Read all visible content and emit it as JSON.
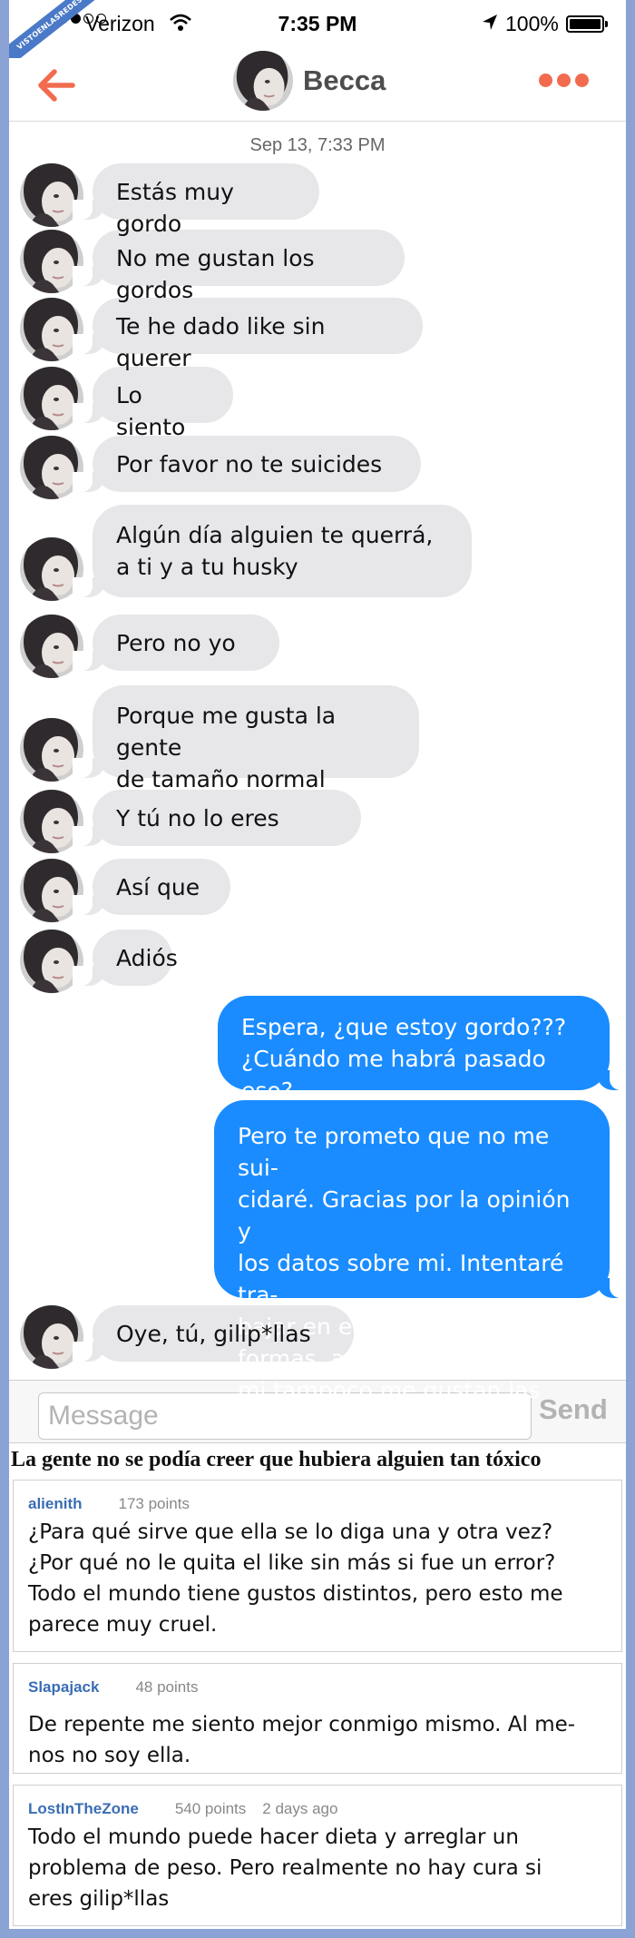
{
  "watermark": "VISTOENLASREDES",
  "status_bar": {
    "carrier": "Verizon",
    "time": "7:35 PM",
    "battery": "100%"
  },
  "nav": {
    "contact_name": "Becca",
    "back_icon": "arrow-left-icon",
    "more_icon": "more-dots-icon"
  },
  "chat": {
    "timestamp": "Sep 13, 7:33 PM",
    "messages": [
      {
        "from": "them",
        "text": "Estás muy gordo"
      },
      {
        "from": "them",
        "text": "No me gustan los gordos"
      },
      {
        "from": "them",
        "text": "Te he dado like sin querer"
      },
      {
        "from": "them",
        "text": "Lo siento"
      },
      {
        "from": "them",
        "text": "Por favor no te suicides"
      },
      {
        "from": "them",
        "text": "Algún día alguien te querrá,\na ti y a tu husky"
      },
      {
        "from": "them",
        "text": "Pero no yo"
      },
      {
        "from": "them",
        "text": "Porque me gusta la gente\nde tamaño normal"
      },
      {
        "from": "them",
        "text": "Y tú no lo eres"
      },
      {
        "from": "them",
        "text": "Así que"
      },
      {
        "from": "them",
        "text": "Adiós"
      },
      {
        "from": "me",
        "text": "Espera, ¿que estoy gordo???\n¿Cuándo me habrá pasado eso?"
      },
      {
        "from": "me",
        "text": "Pero te prometo que no me sui-\ncidaré. Gracias por la opinión y\nlos datos sobre mi. Intentaré tra-\nbajar en ello. De todas formas, a\nmi tampoco me gustan las z*rras"
      },
      {
        "from": "them",
        "text": "Oye, tú, gilip*llas"
      }
    ]
  },
  "composer": {
    "placeholder": "Message",
    "send_label": "Send"
  },
  "headline": "La gente no se podía creer que hubiera alguien tan tóxico",
  "comments": [
    {
      "user": "alienith",
      "points": "173 points",
      "age": "",
      "text": "¿Para qué sirve que ella se lo diga una y otra vez?\n¿Por qué no le quita el like sin más si fue un error?\nTodo el mundo tiene gustos distintos, pero esto me\nparece muy cruel."
    },
    {
      "user": "Slapajack",
      "points": "48 points",
      "age": "",
      "text": "De repente me siento mejor conmigo mismo. Al me-\nnos no soy ella."
    },
    {
      "user": "LostInTheZone",
      "points": "540 points",
      "age": "2 days ago",
      "text": "Todo el mundo puede hacer dieta y arreglar un\nproblema de peso. Pero realmente no hay cura si\neres gilip*llas"
    }
  ],
  "colors": {
    "accent": "#f26b4f",
    "outgoing_bubble": "#1a8cff",
    "incoming_bubble": "#e7e7ea",
    "background": "#8aa3d4"
  }
}
